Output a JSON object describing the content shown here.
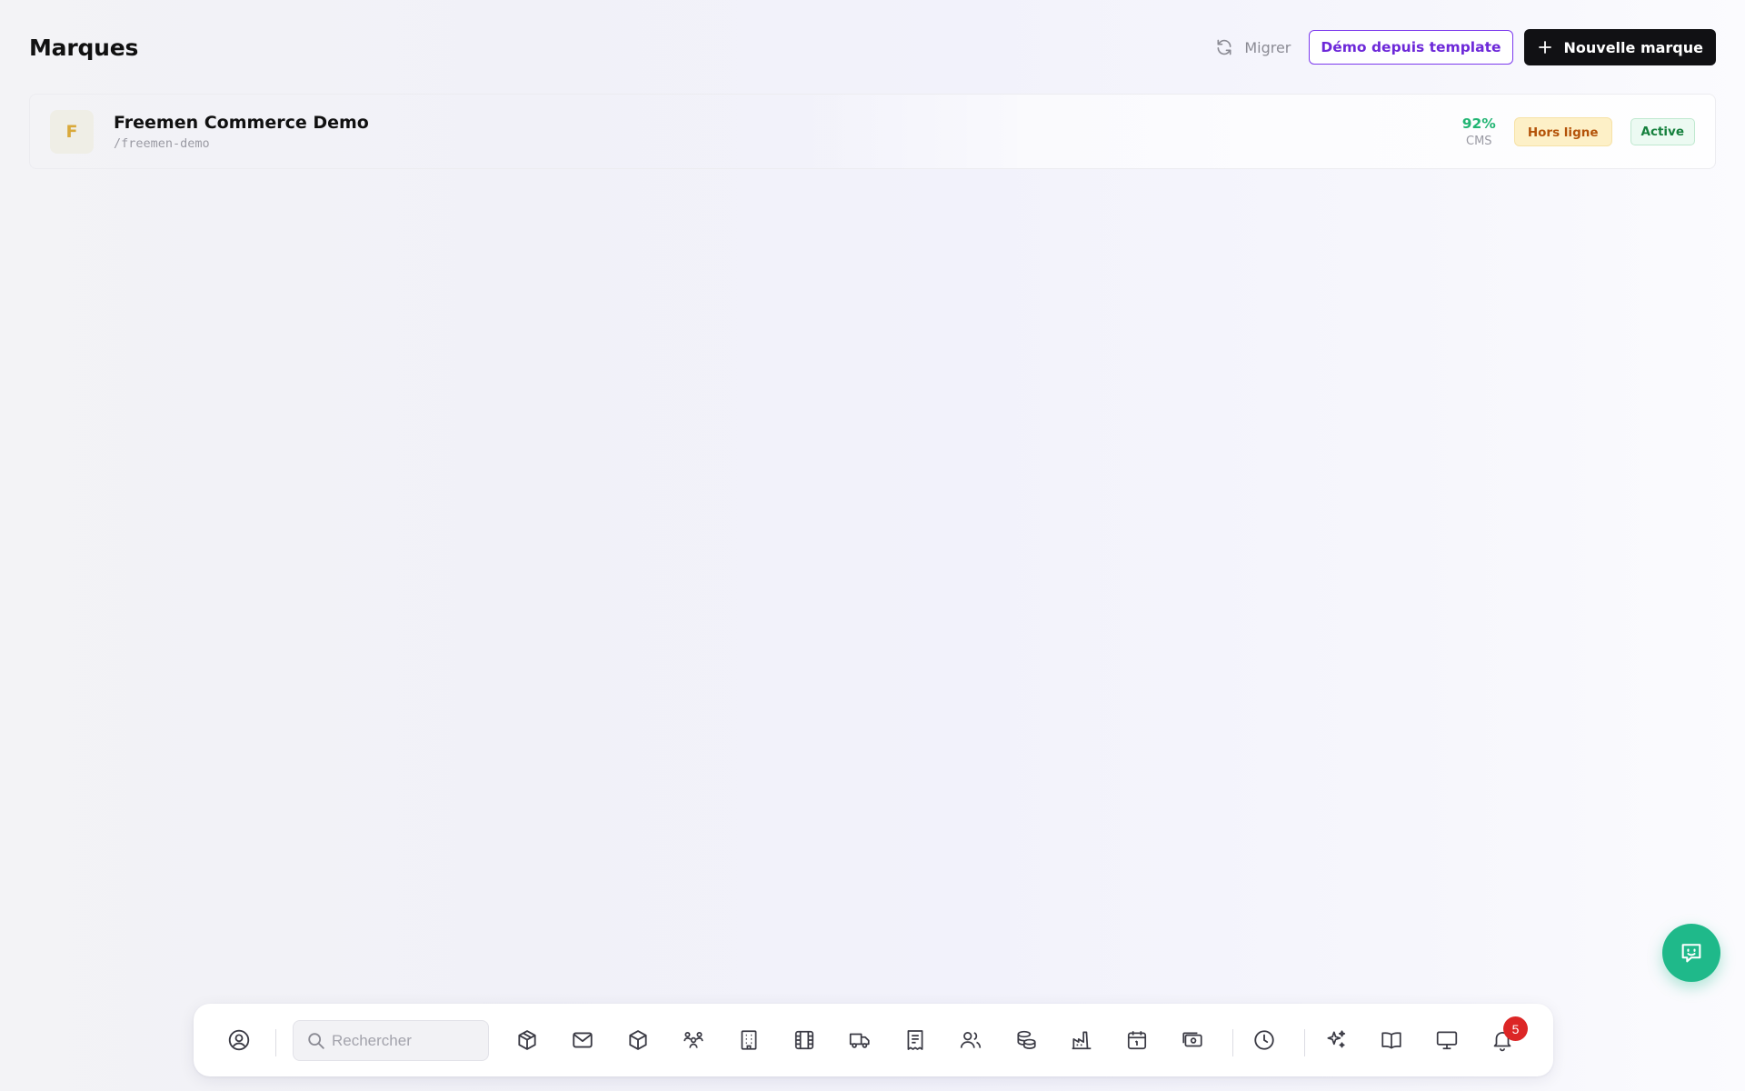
{
  "page": {
    "title": "Marques"
  },
  "header": {
    "migrate_label": "Migrer",
    "demo_label": "Démo depuis template",
    "new_label": "Nouvelle marque"
  },
  "brands": [
    {
      "initial": "F",
      "name": "Freemen Commerce Demo",
      "slug": "/freemen-demo",
      "cms_percent": "92%",
      "cms_label": "CMS",
      "status_online": "Hors ligne",
      "status_active": "Active"
    }
  ],
  "dock": {
    "search_placeholder": "Rechercher",
    "notification_count": "5",
    "icons": [
      "user-circle-icon",
      "package-icon",
      "mail-icon",
      "box-icon",
      "team-icon",
      "building-icon",
      "film-icon",
      "truck-icon",
      "receipt-icon",
      "users-icon",
      "coins-icon",
      "factory-icon",
      "calendar-icon",
      "cash-icon",
      "clock-icon",
      "sparkles-icon",
      "book-icon",
      "monitor-icon",
      "bell-icon"
    ]
  },
  "colors": {
    "accent_purple": "#7c3aed",
    "success_green": "#22b573",
    "warning_bg": "#fdf0c7",
    "fab_green": "#1fb98a",
    "badge_red": "#dc2626"
  }
}
